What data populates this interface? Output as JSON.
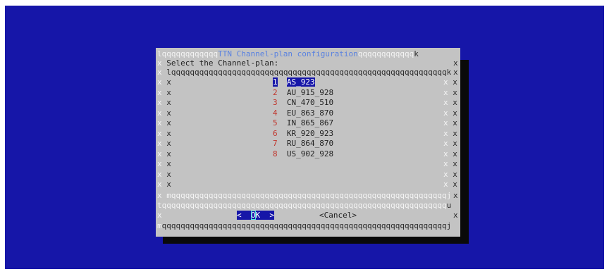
{
  "window": {
    "title": "TTN Channel-plan configuration",
    "prompt": "Select the Channel-plan:"
  },
  "colors": {
    "terminal_bg": "#1616a8",
    "dialog_bg": "#c3c3c3",
    "shadow": "#0a0a0a",
    "title_text": "#5a82e0",
    "hotkey_number": "#c0342b",
    "selection_bg": "#1616a8"
  },
  "menu": {
    "selected_index": 0,
    "items": [
      {
        "number": "1",
        "label": "AS_923"
      },
      {
        "number": "2",
        "label": "AU_915_928"
      },
      {
        "number": "3",
        "label": "CN_470_510"
      },
      {
        "number": "4",
        "label": "EU_863_870"
      },
      {
        "number": "5",
        "label": "IN_865_867"
      },
      {
        "number": "6",
        "label": "KR_920_923"
      },
      {
        "number": "7",
        "label": "RU_864_870"
      },
      {
        "number": "8",
        "label": "US_902_928"
      }
    ]
  },
  "buttons": {
    "ok_left": "<  ",
    "ok_hot": "O",
    "ok_rest": "K  >",
    "cancel": "<Cancel>"
  }
}
